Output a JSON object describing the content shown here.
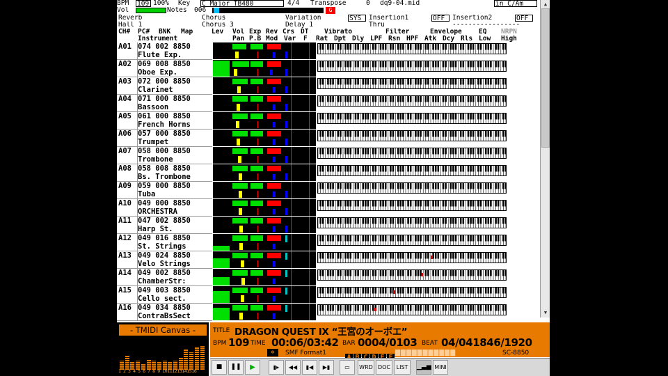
{
  "top": {
    "line1": {
      "bpm_label": "BPM",
      "bpm": "109",
      "pct": "100%",
      "key_label": "Key",
      "key": "C Major",
      "tb": "TB480",
      "sig": "4/4",
      "transpose_label": "Transpose",
      "transpose": "0",
      "file": "dq9-04.mid",
      "incam": "in C/Am"
    },
    "line2": {
      "vol_label": "Vol",
      "notes_label": "Notes",
      "notes": "006",
      "g": "G"
    },
    "line3": {
      "reverb": "Reverb",
      "chorus": "Chorus",
      "variation": "Variation",
      "sys": "SYS",
      "ins1": "Insertion1",
      "off1": "OFF",
      "ins2": "Insertion2",
      "off2": "OFF"
    },
    "line4": {
      "hall": "Hall 1",
      "chorus3": "Chorus 3",
      "delay": "Delay 1",
      "thru": "Thru",
      "dashes": "-----------------"
    },
    "line5": {
      "ch": "CH#",
      "pc": "PC#",
      "bnk": "BNK",
      "map": "Map",
      "lev": "Lev",
      "vol": "Vol",
      "exp": "Exp",
      "rev": "Rev",
      "crs": "Crs",
      "dt": "DT",
      "vibrato": "Vibrato",
      "filter": "Filter",
      "envelope": "Envelope",
      "eq": "EQ",
      "nrpn": "NRPN"
    },
    "line6": {
      "instrument": "Instrument",
      "pan": "Pan",
      "pb": "P.B",
      "mod": "Mod",
      "var": "Var",
      "f": "F",
      "rat": "Rat",
      "dpt": "Dpt",
      "dly": "Dly",
      "lpf": "LPF",
      "rsn": "Rsn",
      "hpf": "HPF",
      "atk": "Atk",
      "dcy": "Dcy",
      "rls": "Rls",
      "low": "Low",
      "high": "High"
    }
  },
  "channels": [
    {
      "ch": "A01",
      "prog": "074 002 8850",
      "inst": "Flute Exp.",
      "lev": 0.0,
      "vol": 0.45,
      "exp": 0.7,
      "pan": 0.2,
      "marker": "#0000ff",
      "note": null
    },
    {
      "ch": "A02",
      "prog": "069 008 8850",
      "inst": "Oboe Exp.",
      "lev": 0.95,
      "vol": 0.55,
      "exp": 0.7,
      "pan": 0.1,
      "marker": "#0000ff",
      "note": null
    },
    {
      "ch": "A03",
      "prog": "072 000 8850",
      "inst": "Clarinet",
      "lev": 0.0,
      "vol": 0.5,
      "exp": 0.7,
      "pan": 0.35,
      "marker": "#0000ff",
      "note": null
    },
    {
      "ch": "A04",
      "prog": "071 000 8850",
      "inst": "Bassoon",
      "lev": 0.0,
      "vol": 0.5,
      "exp": 0.7,
      "pan": 0.3,
      "marker": "#0000ff",
      "note": null
    },
    {
      "ch": "A05",
      "prog": "061 000 8850",
      "inst": "French Horns",
      "lev": 0.0,
      "vol": 0.5,
      "exp": 0.7,
      "pan": 0.25,
      "marker": "#0000ff",
      "note": null
    },
    {
      "ch": "A06",
      "prog": "057 000 8850",
      "inst": "Trumpet",
      "lev": 0.0,
      "vol": 0.5,
      "exp": 0.7,
      "pan": 0.3,
      "marker": "#0000ff",
      "note": null
    },
    {
      "ch": "A07",
      "prog": "058 000 8850",
      "inst": "Trombone",
      "lev": 0.0,
      "vol": 0.5,
      "exp": 0.7,
      "pan": 0.4,
      "marker": "#0000ff",
      "note": null
    },
    {
      "ch": "A08",
      "prog": "058 008 8850",
      "inst": "Bs. Trombone",
      "lev": 0.0,
      "vol": 0.5,
      "exp": 0.7,
      "pan": 0.45,
      "marker": "#0000ff",
      "note": null
    },
    {
      "ch": "A09",
      "prog": "059 000 8850",
      "inst": "Tuba",
      "lev": 0.0,
      "vol": 0.5,
      "exp": 0.7,
      "pan": 0.45,
      "marker": "#0000ff",
      "note": null
    },
    {
      "ch": "A10",
      "prog": "049 000 8850",
      "inst": "ORCHESTRA",
      "lev": 0.0,
      "vol": 0.5,
      "exp": 0.7,
      "pan": 0.45,
      "marker": "#0000ff",
      "note": null
    },
    {
      "ch": "A11",
      "prog": "047 002 8850",
      "inst": "Harp St.",
      "lev": 0.0,
      "vol": 0.5,
      "exp": 0.7,
      "pan": 0.5,
      "marker": "#0000ff",
      "note": null
    },
    {
      "ch": "A12",
      "prog": "049 016 8850",
      "inst": "St. Strings",
      "lev": 0.3,
      "vol": 0.5,
      "exp": 0.7,
      "pan": 0.5,
      "marker": "#00c0c0",
      "note": null
    },
    {
      "ch": "A13",
      "prog": "049 024 8850",
      "inst": "Velo Strings",
      "lev": 0.6,
      "vol": 0.5,
      "exp": 0.7,
      "pan": 0.6,
      "marker": "#00c0c0",
      "note": 0.6
    },
    {
      "ch": "A14",
      "prog": "049 002 8850",
      "inst": "ChamberStr:",
      "lev": 0.5,
      "vol": 0.5,
      "exp": 0.7,
      "pan": 0.65,
      "marker": "#00c0c0",
      "note": 0.55
    },
    {
      "ch": "A15",
      "prog": "049 003 8850",
      "inst": "Cello sect.",
      "lev": 0.7,
      "vol": 0.5,
      "exp": 0.7,
      "pan": 0.6,
      "marker": "#00c0c0",
      "note": 0.4
    },
    {
      "ch": "A16",
      "prog": "049 034 8850",
      "inst": "ContraBsSect",
      "lev": 0.75,
      "vol": 0.5,
      "exp": 0.7,
      "pan": 0.5,
      "marker": "#00c0c0",
      "note": 0.3
    }
  ],
  "canvas": {
    "title": "- TMIDI Canvas -",
    "nums": "1 2 3 4 5 6 7 8 9 10111213141516",
    "levels": [
      0.3,
      0.5,
      0.25,
      0.3,
      0.2,
      0.35,
      0.3,
      0.25,
      0.3,
      0.25,
      0.3,
      0.4,
      0.7,
      0.6,
      0.75,
      0.8
    ]
  },
  "info": {
    "title_label": "TITLE",
    "title": "DRAGON QUEST IX “王宮のオーボエ”",
    "bpm_label": "BPM",
    "bpm": "109",
    "time_label": "TIME",
    "time": "00:06/03:42",
    "bar_label": "BAR",
    "bar": "0004/0103",
    "beat_label": "BEAT",
    "beat": "04/041846/1920",
    "format": "SMF Format1",
    "letters": [
      "A",
      "B",
      "C",
      "D",
      "E",
      "F"
    ],
    "sc": "SC-8850"
  },
  "toolbar": {
    "wrd": "WRD",
    "doc": "DOC",
    "list": "LIST",
    "mini": "MINI"
  },
  "colors": {
    "accent": "#e87a00",
    "green": "#00e000",
    "yellow": "#ffff00",
    "red": "#ff0000"
  }
}
